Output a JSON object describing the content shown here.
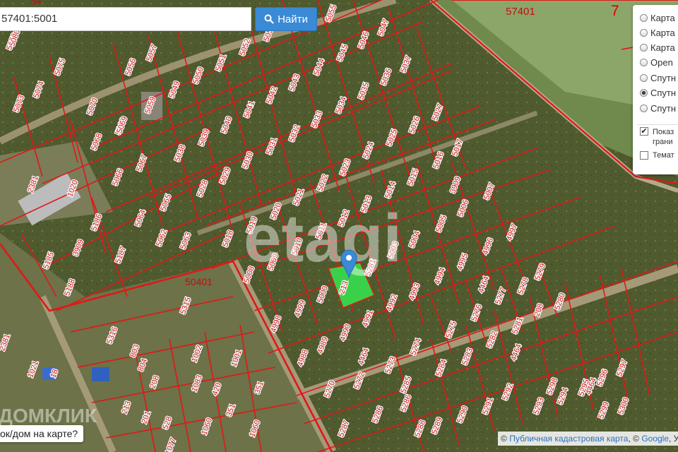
{
  "search": {
    "value": "57401:5001",
    "button_label": "Найти",
    "button_icon": "search-icon"
  },
  "layers": {
    "options": [
      {
        "label": "Карта",
        "checked": false
      },
      {
        "label": "Карта",
        "checked": false
      },
      {
        "label": "Карта",
        "checked": false
      },
      {
        "label": "Open",
        "checked": false
      },
      {
        "label": "Спутн",
        "checked": false
      },
      {
        "label": "Спутн",
        "checked": true
      },
      {
        "label": "Спутн",
        "checked": false
      }
    ],
    "show_borders_line1": "Показ",
    "show_borders_line2": "грани",
    "show_borders_checked": true,
    "thematic_label": "Темат",
    "thematic_checked": false
  },
  "bottom_question": "ок/дом на карте?",
  "attribution": {
    "prefix": "©",
    "link1": "Публичная кадастровая карта",
    "mid": ", ©",
    "link2": "Google",
    "tail": ", Ус"
  },
  "watermark": "etagi",
  "watermark2": "ДОМКЛИК",
  "area_labels": {
    "top": "57401",
    "corner": "7",
    "mid": "50401",
    "partial_top": "54"
  },
  "colors": {
    "boundary": "#e01818",
    "highlight": "#3ad14a",
    "pin": "#3a8ad6",
    "label_bg": "#ffffff",
    "label_text": "#c01010"
  },
  "selected_parcel": "5001",
  "parcels": [
    "5001",
    "5002",
    "5003",
    "5004",
    "5005",
    "5006",
    "5007",
    "5008",
    "5009",
    "5010",
    "5011",
    "5012",
    "5013",
    "5014",
    "5015",
    "5016",
    "5017",
    "5018",
    "5019",
    "5020",
    "5021",
    "5022",
    "5023",
    "5024",
    "5025",
    "5026",
    "5027",
    "5028",
    "5029",
    "5030",
    "5031",
    "5032",
    "5033",
    "5034",
    "5035",
    "5036",
    "5037",
    "5038",
    "5039",
    "5040",
    "5041",
    "5042",
    "5043",
    "5044",
    "5045",
    "5046",
    "5047",
    "5049",
    "5050",
    "5051",
    "5052",
    "5053",
    "5055",
    "5056",
    "5057",
    "5058",
    "5059",
    "5060",
    "5062",
    "5063",
    "5064",
    "5065",
    "5066",
    "5067",
    "5068",
    "5069",
    "5070",
    "5073",
    "5074",
    "5075",
    "5080",
    "5185",
    "5186",
    "5187",
    "5188",
    "3909",
    "3909",
    "2381",
    "4990",
    "4991",
    "4992",
    "4993",
    "4994",
    "4995",
    "4996",
    "4997",
    "4998",
    "4999",
    "5000",
    "4988",
    "4989",
    "4464",
    "4464",
    "4464",
    "4464",
    "5270",
    "5272",
    "5273",
    "5274",
    "5275",
    "5276",
    "5277",
    "5278",
    "5279",
    "5280",
    "5281",
    "5282",
    "5283",
    "5284",
    "5285",
    "5286",
    "5286",
    "5287",
    "5288",
    "5289",
    "5290",
    "5291",
    "5292",
    "5293",
    "5294",
    "5295",
    "5296",
    "5297",
    "5298",
    "5299",
    "5300",
    "5315",
    "5316",
    "803",
    "804",
    "1002",
    "1001",
    "1083",
    "420",
    "208",
    "213",
    "351",
    "351",
    "1060",
    "1060",
    "1077",
    "1020",
    "1021",
    "2381",
    "18",
    "201",
    "528",
    "208",
    "213",
    "5281"
  ]
}
